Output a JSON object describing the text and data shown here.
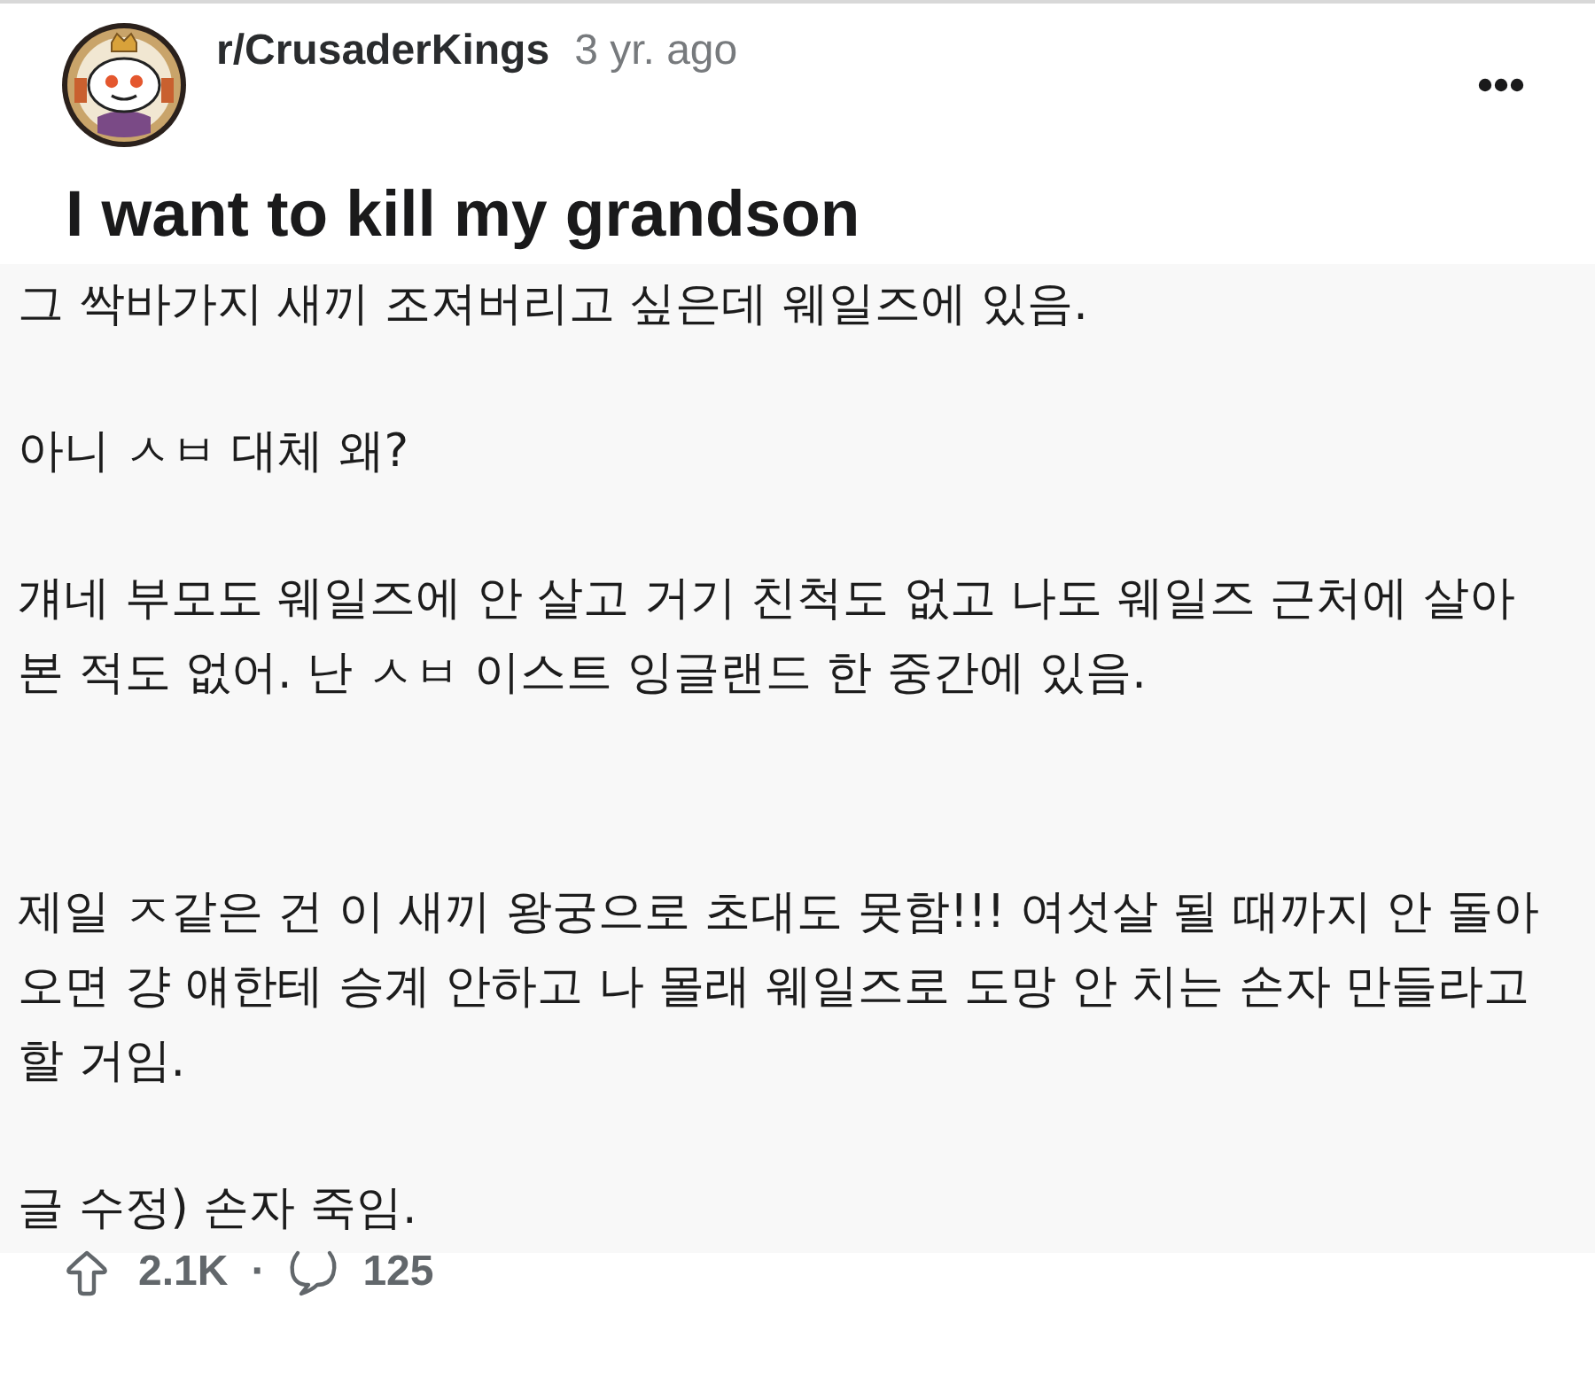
{
  "post": {
    "subreddit": "r/CrusaderKings",
    "age": "3 yr. ago",
    "title": "I want to kill my grandson",
    "body": [
      "그 싹바가지 새끼 조져버리고 싶은데 웨일즈에 있음.",
      "아니 ㅅㅂ 대체 왜?",
      "걔네 부모도 웨일즈에 안 살고 거기 친척도 없고 나도 웨일즈 근처에 살아 본 적도 없어. 난 ㅅㅂ 이스트 잉글랜드 한 중간에 있음.",
      "제일 ㅈ같은 건 이 새끼 왕궁으로 초대도 못함!!! 여섯살 될 때까지 안 돌아오면 걍 얘한테 승계 안하고 나 몰래 웨일즈로 도망 안 치는 손자 만들라고 할 거임.",
      "글 수정) 손자 죽임."
    ],
    "votes": "2.1K",
    "separator": "·",
    "comments": "125"
  }
}
